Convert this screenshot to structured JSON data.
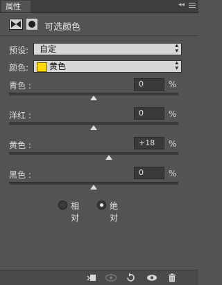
{
  "panel": {
    "tab_label": "属性",
    "title": "可选颜色"
  },
  "preset": {
    "label": "预设:",
    "value": "自定"
  },
  "colors": {
    "label": "颜色:",
    "value": "黄色",
    "swatch_color": "#ffd800"
  },
  "sliders": [
    {
      "label": "青色 :",
      "value": "0",
      "unit": "%",
      "level": 0
    },
    {
      "label": "洋红 :",
      "value": "0",
      "unit": "%",
      "level": 0
    },
    {
      "label": "黄色 :",
      "value": "+18",
      "unit": "%",
      "level": 18
    },
    {
      "label": "黑色 :",
      "value": "0",
      "unit": "%",
      "level": 0
    }
  ],
  "method": {
    "options": [
      {
        "label": "相对",
        "checked": false
      },
      {
        "label": "绝对",
        "checked": true
      }
    ]
  },
  "icons": {
    "adjustment": "selective-color-icon",
    "mask": "mask-icon",
    "clip": "clip-to-layer-icon",
    "view_previous": "view-previous-icon",
    "reset": "reset-icon",
    "visibility": "eye-icon",
    "delete": "trash-icon"
  }
}
